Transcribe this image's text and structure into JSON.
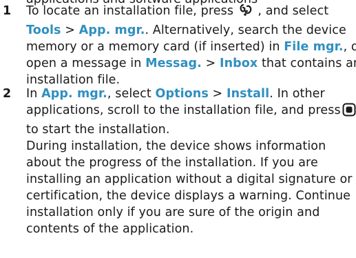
{
  "top_clip": "applications and software applications",
  "step1": {
    "number": "1",
    "line1": {
      "t1": "To locate an installation file, press ",
      "t2": " , and select"
    },
    "line2": {
      "u1": "Tools",
      "sep1": " > ",
      "u2": "App. mgr.",
      "t1": ". Alternatively, search the device"
    },
    "line3": {
      "t1": "memory or a memory card (if inserted) in ",
      "u1": "File mgr.",
      "t2": ", or"
    },
    "line4": {
      "t1": "open a message in ",
      "u1": "Messag.",
      "sep1": " > ",
      "u2": "Inbox",
      "t2": " that contains an"
    },
    "line5": "installation file."
  },
  "step2": {
    "number": "2",
    "line1": {
      "t1": "In ",
      "u1": "App. mgr.",
      "t2": ", select ",
      "u2": "Options",
      "sep1": " > ",
      "u3": "Install",
      "t3": ". In other"
    },
    "line2": {
      "t1": "applications, scroll to the installation file, and press"
    },
    "line3": "to start the installation.",
    "para2": [
      "During installation, the device shows information",
      "about the progress of the installation. If you are",
      "installing an application without a digital signature or",
      "certification, the device displays a warning. Continue",
      "installation only if you are sure of the origin and",
      "contents of the application."
    ]
  },
  "icons": {
    "menu_key": "menu-key-icon",
    "select_key": "scroll-select-key-icon"
  },
  "colors": {
    "ui_text": "#2f8fc0",
    "body_text": "#1a1a1a"
  }
}
